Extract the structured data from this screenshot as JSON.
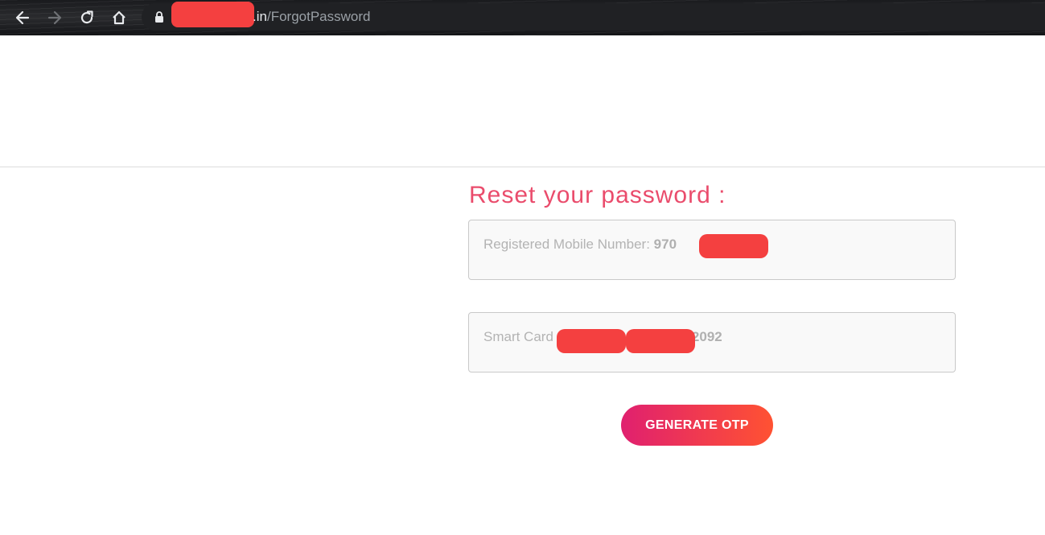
{
  "browser": {
    "url_domain_suffix": ".in",
    "url_path": "/ForgotPassword",
    "icons": [
      "back-icon",
      "forward-icon",
      "reload-icon",
      "home-icon",
      "lock-icon"
    ]
  },
  "form": {
    "title": "Reset your password :",
    "mobile_label": "Registered Mobile Number:",
    "mobile_value": "970",
    "smart_card_label": "Smart Card",
    "smart_card_value": "2092",
    "submit_label": "GENERATE OTP"
  },
  "colors": {
    "title": "#ea4c6c",
    "button_start": "#e0206f",
    "button_end": "#ff5232",
    "redaction": "#f44040"
  }
}
